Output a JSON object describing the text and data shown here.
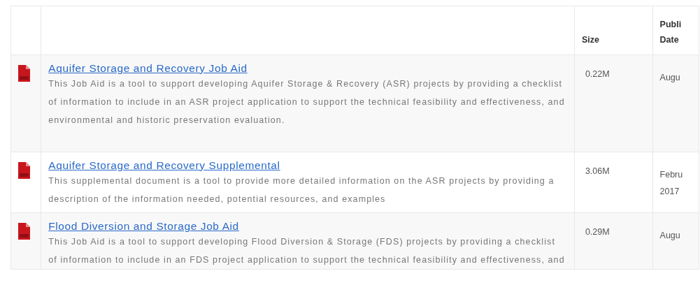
{
  "table": {
    "columns": [
      {},
      {},
      {
        "label": "Size"
      },
      {
        "label": "Publi\nDate"
      }
    ],
    "rows": [
      {
        "title": "Aquifer Storage and Recovery Job Aid",
        "description": "This Job Aid is a tool to support developing Aquifer Storage & Recovery (ASR) projects by providing a checklist of information to include in an ASR project application to support the technical feasibility and effectiveness, and environmental and historic preservation evaluation.",
        "size": "0.22M",
        "date": "Augu"
      },
      {
        "title": "Aquifer Storage and Recovery Supplemental",
        "description": "This supplemental document is a tool to provide more detailed information on the ASR projects by providing a description of the information needed, potential resources, and examples",
        "size": "3.06M",
        "date": "Febru\n2017"
      },
      {
        "title": "Flood Diversion and Storage Job Aid",
        "description": "This Job Aid is a tool to support developing Flood Diversion & Storage (FDS) projects by providing a checklist of information to include in an FDS project application to support the technical feasibility and effectiveness, and",
        "size": "0.29M",
        "date": "Augu"
      }
    ]
  }
}
